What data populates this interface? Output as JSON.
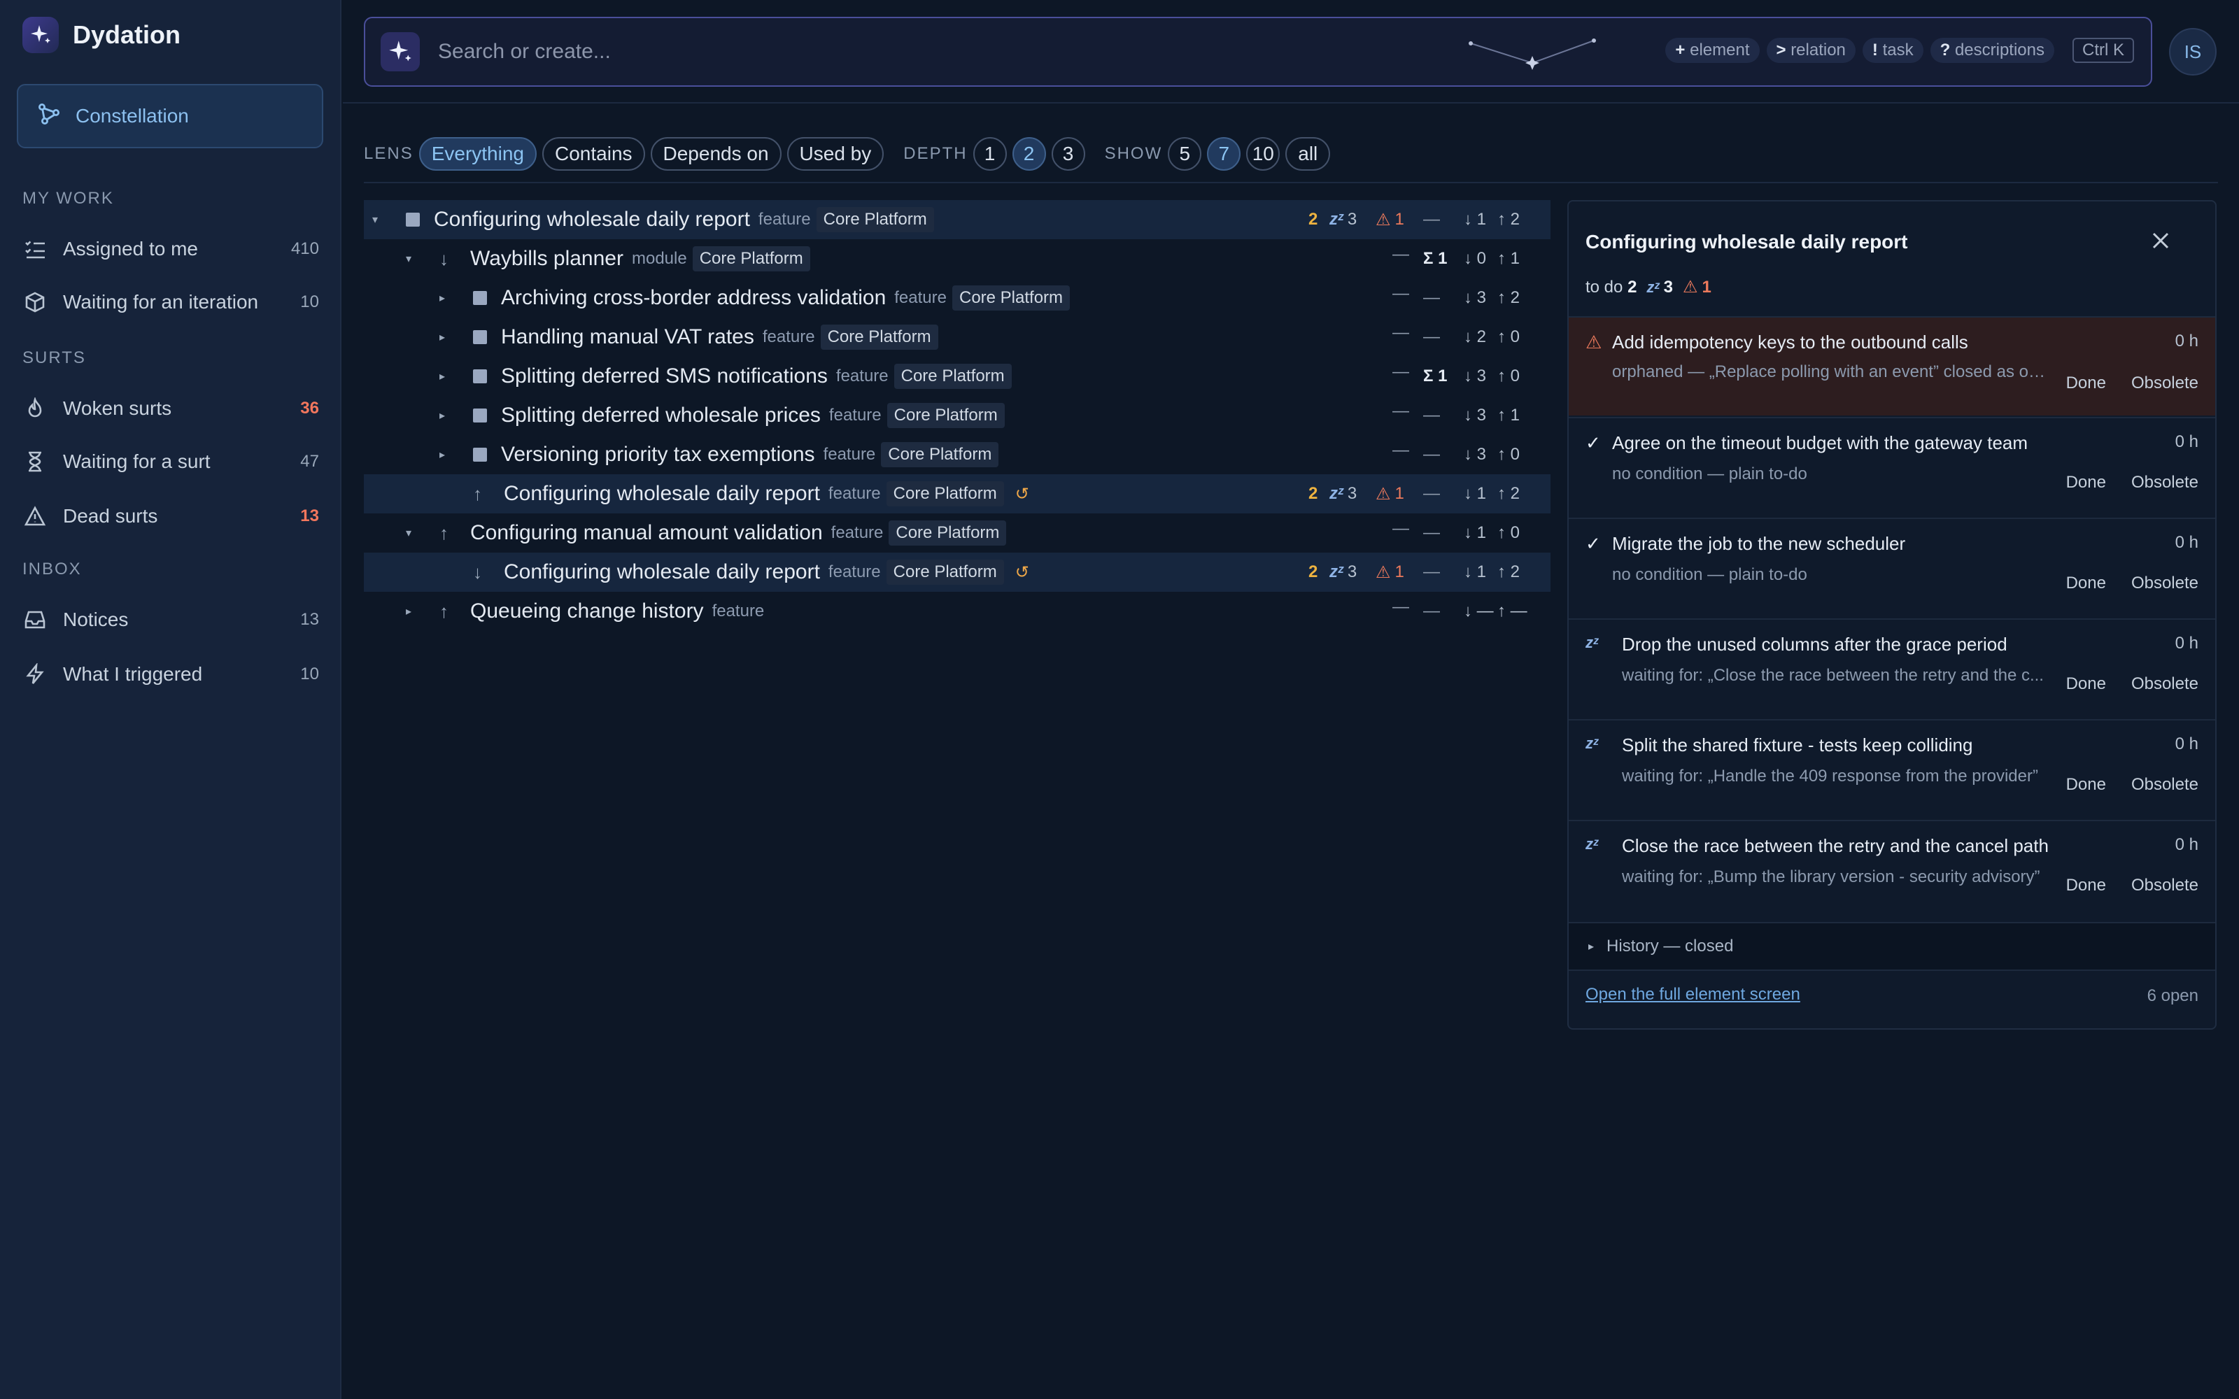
{
  "app": {
    "name": "Dydation"
  },
  "sidebar": {
    "primary": {
      "label": "Constellation",
      "icon": "constellation-icon"
    },
    "sections": [
      {
        "title": "MY WORK",
        "items": [
          {
            "label": "Assigned to me",
            "count": "410",
            "icon": "checklist-icon"
          },
          {
            "label": "Waiting for an iteration",
            "count": "10",
            "icon": "box-icon"
          }
        ]
      },
      {
        "title": "SURTS",
        "items": [
          {
            "label": "Woken surts",
            "count": "36",
            "icon": "flame-icon",
            "alert": true
          },
          {
            "label": "Waiting for a surt",
            "count": "47",
            "icon": "hourglass-icon"
          },
          {
            "label": "Dead surts",
            "count": "13",
            "icon": "warning-icon",
            "alert": true
          }
        ]
      },
      {
        "title": "INBOX",
        "items": [
          {
            "label": "Notices",
            "count": "13",
            "icon": "inbox-icon"
          },
          {
            "label": "What I triggered",
            "count": "10",
            "icon": "bolt-icon"
          }
        ]
      }
    ]
  },
  "search": {
    "placeholder": "Search or create...",
    "hints": [
      {
        "key": "+",
        "label": "element"
      },
      {
        "key": ">",
        "label": "relation"
      },
      {
        "key": "!",
        "label": "task"
      },
      {
        "key": "?",
        "label": "descriptions"
      }
    ],
    "shortcut": "Ctrl K"
  },
  "user": {
    "initials": "IS"
  },
  "filters": {
    "lens_label": "LENS",
    "lens": [
      "Everything",
      "Contains",
      "Depends on",
      "Used by"
    ],
    "lens_selected": "Everything",
    "depth_label": "DEPTH",
    "depth": [
      "1",
      "2",
      "3"
    ],
    "depth_selected": "2",
    "show_label": "SHOW",
    "show": [
      "5",
      "7",
      "10",
      "all"
    ],
    "show_selected": "7"
  },
  "tree": [
    {
      "level": 0,
      "caret": "▾",
      "marker": "square",
      "title": "Configuring wholesale daily report",
      "kind": "feature",
      "tag": "Core Platform",
      "highlight": true,
      "todo": "2",
      "sleep": "3",
      "warn": "1",
      "mid": "—",
      "down": "↓ 1",
      "up": "↑ 2"
    },
    {
      "level": 1,
      "caret": "▾",
      "marker": "down",
      "title": "Waybills planner",
      "kind": "module",
      "tag": "Core Platform",
      "dash": "—",
      "mid": "Σ 1",
      "down": "↓ 0",
      "up": "↑ 1"
    },
    {
      "level": 2,
      "caret": "▸",
      "marker": "square",
      "title": "Archiving cross-border address validation",
      "kind": "feature",
      "tag": "Core Platform",
      "dash": "—",
      "mid": "—",
      "down": "↓ 3",
      "up": "↑ 2"
    },
    {
      "level": 2,
      "caret": "▸",
      "marker": "square",
      "title": "Handling manual VAT rates",
      "kind": "feature",
      "tag": "Core Platform",
      "dash": "—",
      "mid": "—",
      "down": "↓ 2",
      "up": "↑ 0"
    },
    {
      "level": 2,
      "caret": "▸",
      "marker": "square",
      "title": "Splitting deferred SMS notifications",
      "kind": "feature",
      "tag": "Core Platform",
      "dash": "—",
      "mid": "Σ 1",
      "down": "↓ 3",
      "up": "↑ 0"
    },
    {
      "level": 2,
      "caret": "▸",
      "marker": "square",
      "title": "Splitting deferred wholesale prices",
      "kind": "feature",
      "tag": "Core Platform",
      "dash": "—",
      "mid": "—",
      "down": "↓ 3",
      "up": "↑ 1"
    },
    {
      "level": 2,
      "caret": "▸",
      "marker": "square",
      "title": "Versioning priority tax exemptions",
      "kind": "feature",
      "tag": "Core Platform",
      "dash": "—",
      "mid": "—",
      "down": "↓ 3",
      "up": "↑ 0"
    },
    {
      "level": 2,
      "caret": "",
      "marker": "up",
      "title": "Configuring wholesale daily report",
      "kind": "feature",
      "tag": "Core Platform",
      "loop": "↺",
      "highlight": true,
      "todo": "2",
      "sleep": "3",
      "warn": "1",
      "mid": "—",
      "down": "↓ 1",
      "up": "↑ 2"
    },
    {
      "level": 1,
      "caret": "▾",
      "marker": "up",
      "title": "Configuring manual amount validation",
      "kind": "feature",
      "tag": "Core Platform",
      "dash": "—",
      "mid": "—",
      "down": "↓ 1",
      "up": "↑ 0"
    },
    {
      "level": 2,
      "caret": "",
      "marker": "down",
      "title": "Configuring wholesale daily report",
      "kind": "feature",
      "tag": "Core Platform",
      "loop": "↺",
      "highlight": true,
      "todo": "2",
      "sleep": "3",
      "warn": "1",
      "mid": "—",
      "down": "↓ 1",
      "up": "↑ 2"
    },
    {
      "level": 1,
      "caret": "▸",
      "marker": "up",
      "title": "Queueing change history",
      "kind": "feature",
      "dash": "—",
      "mid": "—",
      "down": "↓ —",
      "up": "↑ —"
    }
  ],
  "panel": {
    "title": "Configuring wholesale daily report",
    "summary": {
      "todo_label": "to do",
      "todo": "2",
      "sleep": "3",
      "warn": "1"
    },
    "tasks": [
      {
        "icon": "warning",
        "title": "Add idempotency keys to the outbound calls",
        "sub": "orphaned — „Replace polling with an event” closed as ob...",
        "hours": "0 h",
        "done": "Done",
        "obsolete": "Obsolete",
        "warn": true
      },
      {
        "icon": "check",
        "title": "Agree on the timeout budget with the gateway team",
        "sub": "no condition — plain to-do",
        "hours": "0 h",
        "done": "Done",
        "obsolete": "Obsolete"
      },
      {
        "icon": "check",
        "title": "Migrate the job to the new scheduler",
        "sub": "no condition — plain to-do",
        "hours": "0 h",
        "done": "Done",
        "obsolete": "Obsolete"
      },
      {
        "icon": "sleep",
        "title": "Drop the unused columns after the grace period",
        "sub": "waiting for: „Close the race between the retry and the c...",
        "hours": "0 h",
        "done": "Done",
        "obsolete": "Obsolete"
      },
      {
        "icon": "sleep",
        "title": "Split the shared fixture - tests keep colliding",
        "sub": "waiting for: „Handle the 409 response from the provider”",
        "hours": "0 h",
        "done": "Done",
        "obsolete": "Obsolete"
      },
      {
        "icon": "sleep",
        "title": "Close the race between the retry and the cancel path",
        "sub": "waiting for: „Bump the library version - security advisory”",
        "hours": "0 h",
        "done": "Done",
        "obsolete": "Obsolete"
      }
    ],
    "history_label": "History — closed",
    "open_link": "Open the full element screen",
    "open_count": "6 open"
  },
  "colors": {
    "accent": "#8cc4f2",
    "todo": "#eeb340",
    "warn": "#ec7a5c",
    "sleep": "#8fb4e6"
  }
}
